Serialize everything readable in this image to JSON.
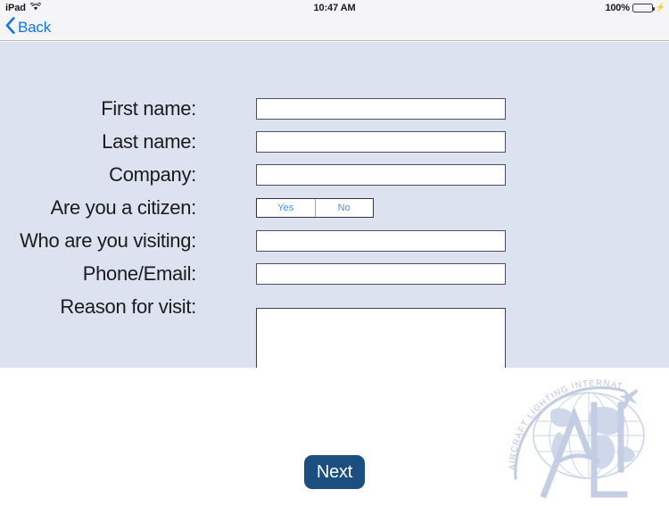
{
  "status_bar": {
    "device": "iPad",
    "wifi_icon": "wifi-icon",
    "time": "10:47 AM",
    "battery_percent": "100%",
    "battery_icon": "battery-icon",
    "charging_icon": "lightning-bolt-icon"
  },
  "nav_bar": {
    "back_icon": "chevron-left-icon",
    "back_label": "Back"
  },
  "form": {
    "rows": [
      {
        "label": "First name:",
        "type": "text",
        "value": "",
        "placeholder": ""
      },
      {
        "label": "Last name:",
        "type": "text",
        "value": "",
        "placeholder": ""
      },
      {
        "label": "Company:",
        "type": "text",
        "value": "",
        "placeholder": ""
      },
      {
        "label": "Are you a citizen:",
        "type": "segmented",
        "options": [
          "Yes",
          "No"
        ],
        "selected": ""
      },
      {
        "label": "Who are you visiting:",
        "type": "text",
        "value": "",
        "placeholder": ""
      },
      {
        "label": "Phone/Email:",
        "type": "text",
        "value": "",
        "placeholder": ""
      },
      {
        "label": "Reason for visit:",
        "type": "textarea",
        "value": "",
        "placeholder": ""
      }
    ],
    "segment_yes": "Yes",
    "segment_no": "No"
  },
  "footer": {
    "next_label": "Next"
  },
  "logo": {
    "name": "aircraft-lighting-international-logo",
    "arc_text": "AIRCRAFT LIGHTING INTERNATIONAL",
    "monogram": "ALI",
    "color": "#c3cde4"
  },
  "colors": {
    "panel_background": "#dde2f1",
    "page_background": "#ffffff",
    "navbar_background": "#f5f5f7",
    "accent_blue": "#1076e8",
    "button_navy": "#1b4f82",
    "segment_text": "#4a90e2",
    "battery_green": "#4cd964"
  }
}
